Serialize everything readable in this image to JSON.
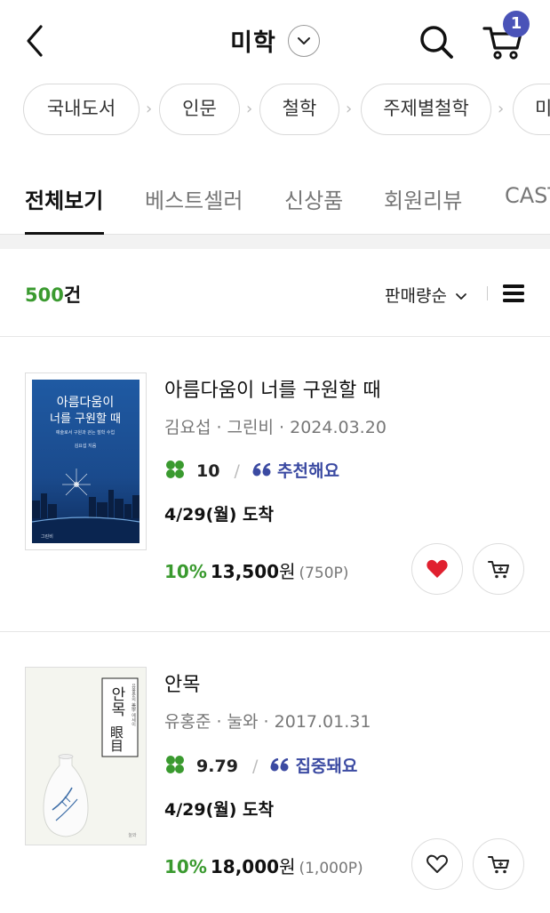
{
  "header": {
    "title": "미학",
    "cart_count": "1",
    "icons": {
      "back": "back-arrow-icon",
      "dropdown": "chevron-down-icon",
      "search": "search-icon",
      "cart": "cart-icon"
    }
  },
  "breadcrumbs": [
    {
      "label": "국내도서"
    },
    {
      "label": "인문"
    },
    {
      "label": "철학"
    },
    {
      "label": "주제별철학"
    },
    {
      "label": "미"
    }
  ],
  "tabs": [
    {
      "label": "전체보기",
      "active": true
    },
    {
      "label": "베스트셀러",
      "active": false
    },
    {
      "label": "신상품",
      "active": false
    },
    {
      "label": "회원리뷰",
      "active": false
    },
    {
      "label": "CAST",
      "active": false
    }
  ],
  "list_header": {
    "count_number": "500",
    "count_suffix": "건",
    "sort_label": "판매량순"
  },
  "products": [
    {
      "title": "아름다움이 너를 구원할 때",
      "meta": "김요섭 · 그린비 · 2024.03.20",
      "rating": "10",
      "review_tag": "추천해요",
      "delivery": "4/29(월) 도착",
      "discount": "10%",
      "price": "13,500",
      "price_unit": "원",
      "points": "(750P)",
      "liked": true,
      "cover": {
        "line1": "아름다움이",
        "line2": "너를 구원할 때",
        "subtitle": "예술로서 구원과 걷는 철학 수업",
        "author": "김요섭 지음",
        "publisher": "그린비"
      }
    },
    {
      "title": "안목",
      "meta": "유홍준 · 눌와 · 2017.01.31",
      "rating": "9.79",
      "review_tag": "집중돼요",
      "delivery": "4/29(월) 도착",
      "discount": "10%",
      "price": "18,000",
      "price_unit": "원",
      "points": "(1,000P)",
      "liked": false,
      "cover": {
        "title_ko": "안목",
        "title_hanja": "眼目",
        "side_text": "유홍준의 美學 에세이",
        "publisher": "눌와"
      }
    }
  ],
  "colors": {
    "accent_green": "#3a9a2f",
    "badge_purple": "#4a53b8",
    "review_blue": "#3b4aa2",
    "heart_red": "#e0202f"
  }
}
